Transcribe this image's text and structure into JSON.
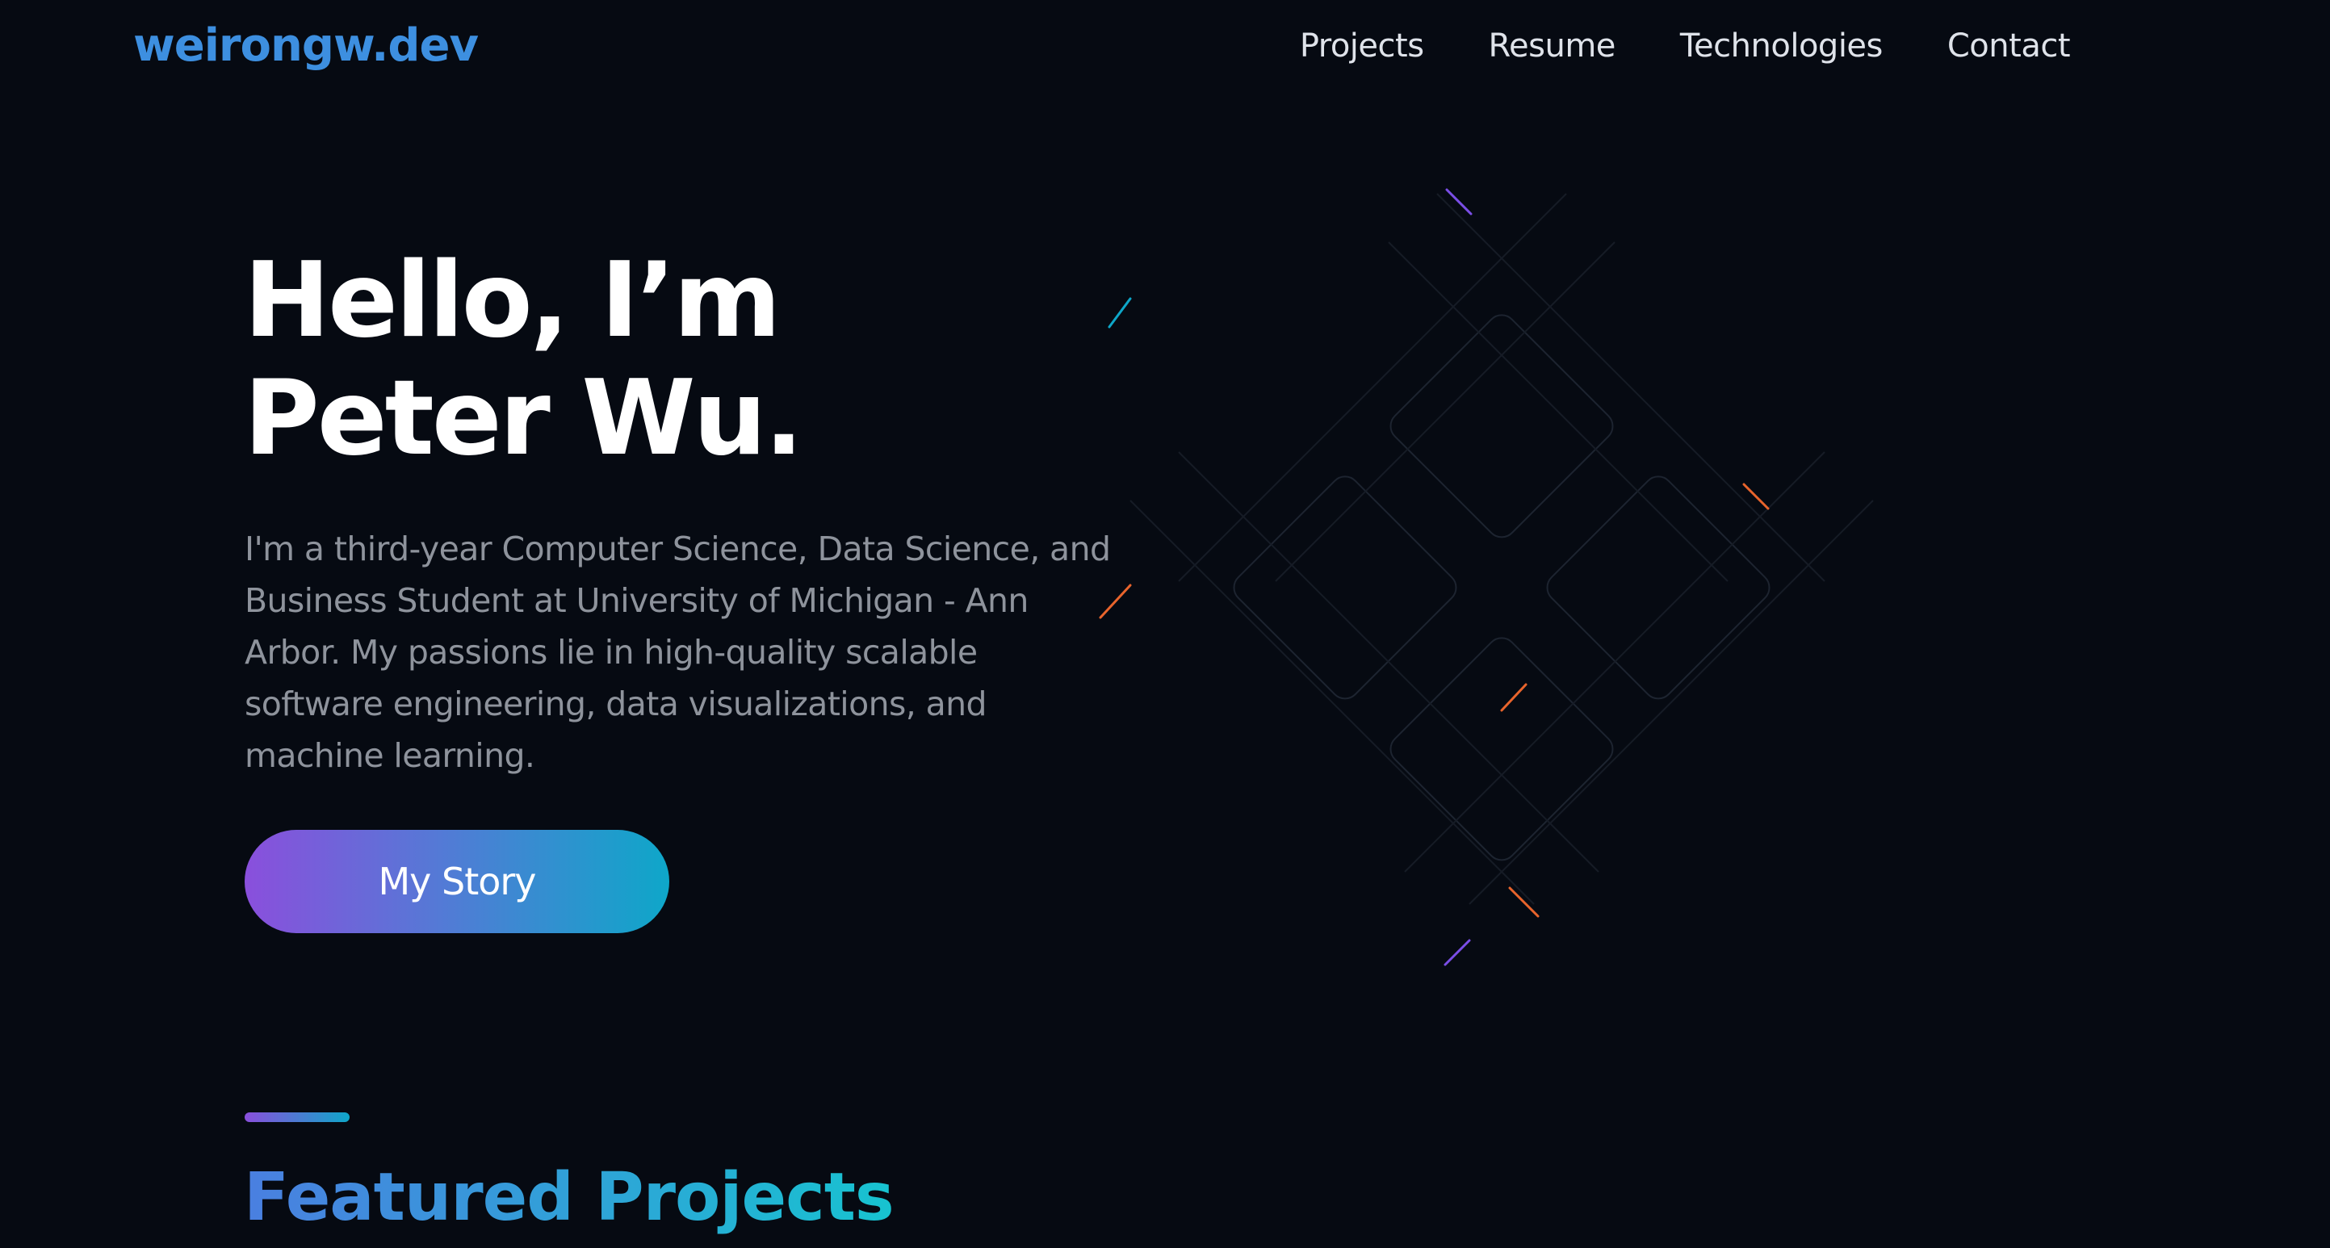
{
  "header": {
    "logo": "weirongw.dev",
    "nav": [
      {
        "label": "Projects"
      },
      {
        "label": "Resume"
      },
      {
        "label": "Technologies"
      },
      {
        "label": "Contact"
      }
    ]
  },
  "hero": {
    "title_line1": "Hello, I’m",
    "title_line2": "Peter Wu.",
    "description": "I'm a third-year Computer Science, Data Science, and Business Student at University of Michigan - Ann Arbor. My passions lie in high-quality scalable software engineering, data visualizations, and machine learning.",
    "cta_label": "My Story"
  },
  "featured": {
    "title": "Featured Projects"
  },
  "colors": {
    "background": "#060a12",
    "logo": "#3d8fe0",
    "gradient_start": "#8a4fdc",
    "gradient_end": "#0ea7c9",
    "accent_orange": "#e8642c"
  }
}
